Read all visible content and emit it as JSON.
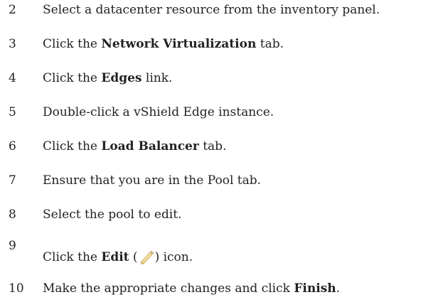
{
  "steps": [
    {
      "num": "2",
      "text": "Select a datacenter resource from the inventory panel."
    },
    {
      "num": "3",
      "pre": "Click the ",
      "bold": "Network Virtualization",
      "post": " tab."
    },
    {
      "num": "4",
      "pre": "Click the ",
      "bold": "Edges",
      "post": " link."
    },
    {
      "num": "5",
      "text": "Double-click a vShield Edge instance."
    },
    {
      "num": "6",
      "pre": "Click the ",
      "bold": "Load Balancer",
      "post": " tab."
    },
    {
      "num": "7",
      "text": "Ensure that you are in the Pool tab."
    },
    {
      "num": "8",
      "text": "Select the pool to edit."
    },
    {
      "num": "9",
      "pre": "Click the ",
      "bold": "Edit",
      "open_paren": " (",
      "icon": "pencil-icon",
      "close": ") icon."
    },
    {
      "num": "10",
      "pre": "Make the appropriate changes and click ",
      "bold": "Finish",
      "post": "."
    }
  ]
}
